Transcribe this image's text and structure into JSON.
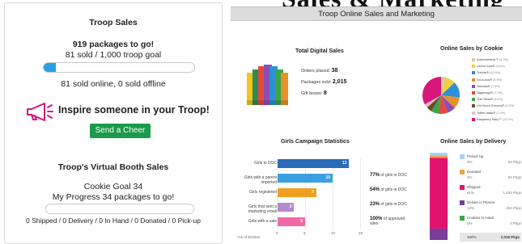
{
  "troop_sales": {
    "title": "Troop Sales",
    "packages_to_go": "919 packages to go!",
    "sold_of_goal": "81 sold / 1,000 troop goal",
    "goal_progress": 0.081,
    "online_offline": "81 sold online, 0 sold offline",
    "inspire_text": "Inspire someone in your Troop!",
    "send_cheer_label": "Send a Cheer"
  },
  "virtual_booth": {
    "title": "Troop's Virtual Booth Sales",
    "cookie_goal": "Cookie Goal 34",
    "my_progress": "My Progress 34 packages to go!",
    "goal_progress": 0,
    "status_line": "0 Shipped / 0 Delivery / 0 In Hand / 0 Donated / 0 Pick-up"
  },
  "right_panel": {
    "bleed_title": "Sales & Marketing",
    "header": "Troop Online Sales and Marketing",
    "total_digital_sales": {
      "title": "Total Digital Sales",
      "orders_label": "Orders placed:",
      "orders_value": "38",
      "packages_label": "Packages sold:",
      "packages_value": "2,015",
      "gift_label": "Gift boxes:",
      "gift_value": "8"
    },
    "online_sales_by_cookie": {
      "title": "Online Sales by Cookie",
      "items": [
        {
          "name": "Adventurefuls™",
          "pct": "(4.3%)",
          "color": "#d9c9a3",
          "value": 4.3
        },
        {
          "name": "Lemon-Ups®",
          "pct": "(8.6%)",
          "color": "#f2d13c",
          "value": 8.6
        },
        {
          "name": "Trefoils®",
          "pct": "(13.9%)",
          "color": "#2f8fd4",
          "value": 13.9
        },
        {
          "name": "Do-si-dos®",
          "pct": "(9.9%)",
          "color": "#e8912b",
          "value": 9.9
        },
        {
          "name": "Samoas®",
          "pct": "(7.5%)",
          "color": "#8a4fb3",
          "value": 7.5
        },
        {
          "name": "Tagalongs®",
          "pct": "(7.9%)",
          "color": "#e64a3c",
          "value": 7.9
        },
        {
          "name": "Thin Mints®",
          "pct": "(6.6%)",
          "color": "#3aa64b",
          "value": 6.6
        },
        {
          "name": "Girl Scout S'mores®",
          "pct": "(4.9%)",
          "color": "#6b4a2b",
          "value": 4.9
        },
        {
          "name": "Toffee-tastic®",
          "pct": "(3.3%)",
          "color": "#f3b9c9",
          "value": 3.3
        },
        {
          "name": "Raspberry Rally™",
          "pct": "(33.0%)",
          "color": "#d6187a",
          "value": 33.0
        }
      ]
    },
    "girls_campaign": {
      "title": "Girls Campaign Statistics",
      "as_of": "*As of 9/13/22",
      "ticks": [
        "0",
        "5",
        "10",
        "15"
      ]
    },
    "online_sales_by_delivery": {
      "title": "Online Sales by Delivery",
      "items": [
        {
          "name": "Picked Up",
          "pct": "0%",
          "pkgs": "63 Pkgs",
          "color": "#a9d4f0",
          "value": 3
        },
        {
          "name": "Donated",
          "pct": "3%",
          "pkgs": "50 Pkgs",
          "color": "#f0a24a",
          "value": 3
        },
        {
          "name": "Shipped",
          "pct": "81%",
          "pkgs": "1,633 Pkgs",
          "color": "#e2136e",
          "value": 81
        },
        {
          "name": "Deliver in Person",
          "pct": "13%",
          "pkgs": "254 Pkgs",
          "color": "#7a3d9a",
          "value": 13
        },
        {
          "name": "Cookies in Hand",
          "pct": "0%",
          "pkgs": "0 Pkgs",
          "color": "#3aa64b",
          "value": 0
        }
      ],
      "total_pct": "100%",
      "total_pkgs": "2,015 Pkgs"
    }
  },
  "chart_data": {
    "type": "bar",
    "title": "Girls Campaign Statistics",
    "categories": [
      "Girls in DOC",
      "Girls with a parent imported",
      "Girls registered",
      "Girls that sent a marketing email",
      "Girls with a sale"
    ],
    "values": [
      13,
      10,
      7,
      3,
      5
    ],
    "colors": [
      "#2a6cb8",
      "#3aa0e0",
      "#f0a020",
      "#b58ad0",
      "#f06aa8"
    ],
    "pct_labels": [
      {
        "value": "",
        "text": ""
      },
      {
        "value": "77%",
        "text": "of girls in DOC"
      },
      {
        "value": "54%",
        "text": "of girls in DOC"
      },
      {
        "value": "23%",
        "text": "of girls in DOC"
      },
      {
        "value": "100%",
        "text": "of approved sites"
      }
    ],
    "xlim": [
      0,
      15
    ],
    "xticks": [
      0,
      5,
      10,
      15
    ]
  }
}
